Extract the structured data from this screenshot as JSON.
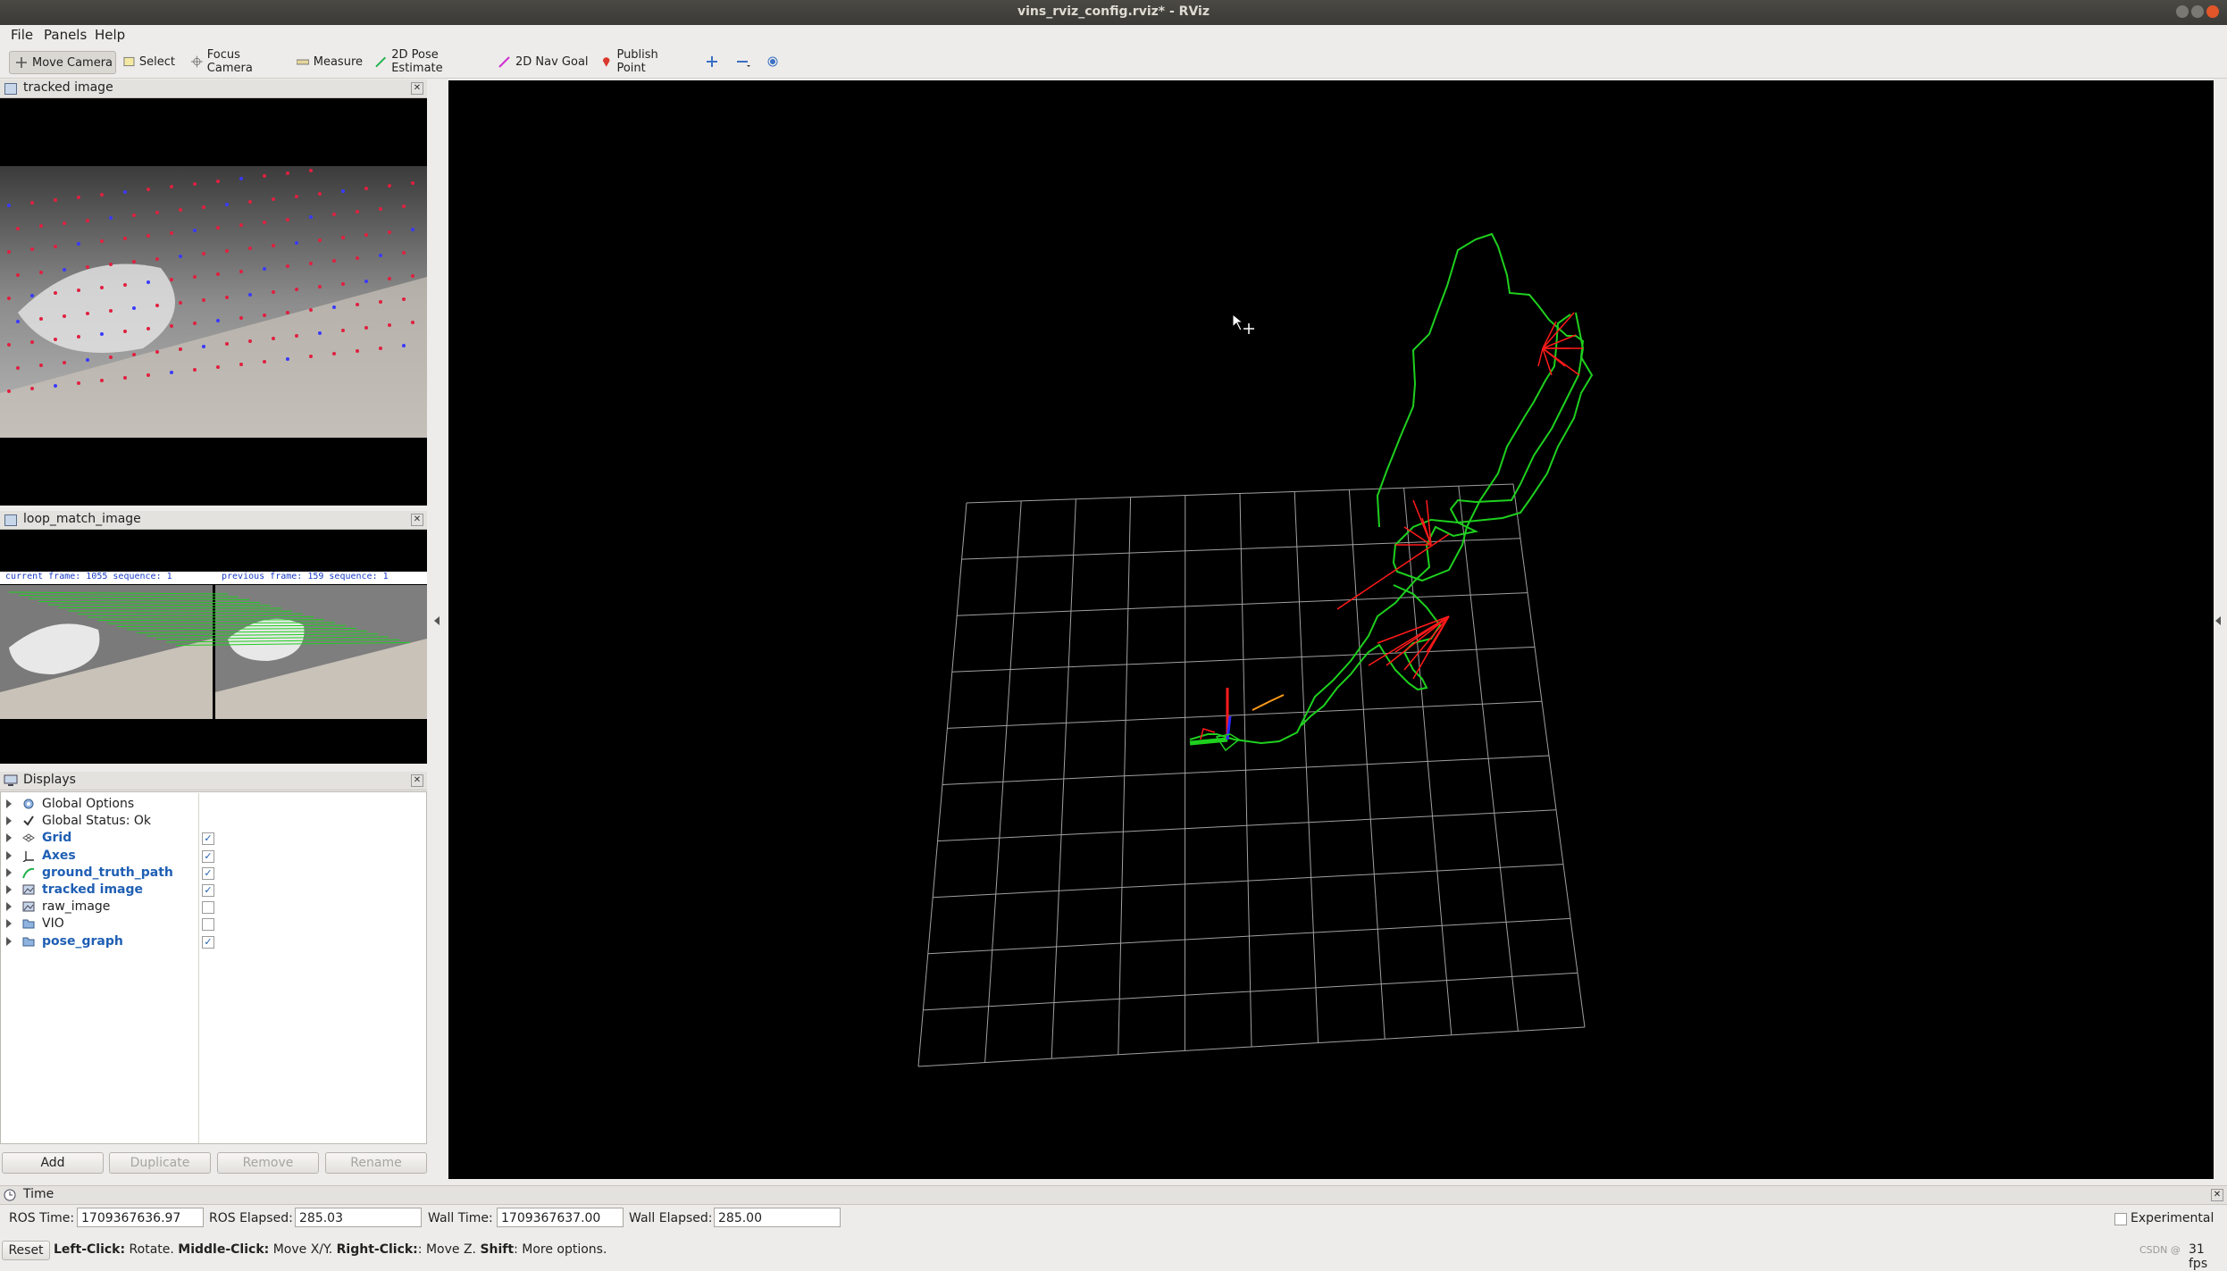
{
  "window": {
    "title": "vins_rviz_config.rviz* - RViz"
  },
  "menubar": {
    "items": [
      "File",
      "Panels",
      "Help"
    ]
  },
  "toolbar": {
    "tools": [
      "Move Camera",
      "Select",
      "Focus Camera",
      "Measure",
      "2D Pose Estimate",
      "2D Nav Goal",
      "Publish Point"
    ],
    "active": "Move Camera"
  },
  "panels": {
    "tracked_image": {
      "title": "tracked image"
    },
    "loop_match_image": {
      "title": "loop_match_image",
      "current_frame_text": "current frame: 1055   sequence: 1",
      "previous_frame_text": "previous frame: 159   sequence: 1"
    },
    "displays": {
      "title": "Displays",
      "items": [
        {
          "label": "Global Options",
          "icon": "gear-icon",
          "checked": null,
          "enabled": false
        },
        {
          "label": "Global Status: Ok",
          "icon": "checkmark-icon",
          "checked": null,
          "enabled": false
        },
        {
          "label": "Grid",
          "icon": "grid-icon",
          "checked": true,
          "enabled": true
        },
        {
          "label": "Axes",
          "icon": "axes-icon",
          "checked": true,
          "enabled": true
        },
        {
          "label": "ground_truth_path",
          "icon": "path-icon",
          "checked": true,
          "enabled": true
        },
        {
          "label": "tracked image",
          "icon": "image-icon",
          "checked": true,
          "enabled": true
        },
        {
          "label": "raw_image",
          "icon": "image-icon",
          "checked": false,
          "enabled": false
        },
        {
          "label": "VIO",
          "icon": "folder-icon",
          "checked": false,
          "enabled": false
        },
        {
          "label": "pose_graph",
          "icon": "folder-icon",
          "checked": true,
          "enabled": true
        }
      ],
      "buttons": {
        "add": "Add",
        "duplicate": "Duplicate",
        "remove": "Remove",
        "rename": "Rename"
      }
    }
  },
  "time_panel": {
    "title": "Time",
    "ros_time_label": "ROS Time:",
    "ros_time": "1709367636.97",
    "ros_elapsed_label": "ROS Elapsed:",
    "ros_elapsed": "285.03",
    "wall_time_label": "Wall Time:",
    "wall_time": "1709367637.00",
    "wall_elapsed_label": "Wall Elapsed:",
    "wall_elapsed": "285.00",
    "experimental_label": "Experimental"
  },
  "statusbar": {
    "reset_label": "Reset",
    "help_left_bold": "Left-Click:",
    "help_left": " Rotate. ",
    "help_middle_bold": "Middle-Click:",
    "help_middle": " Move X/Y. ",
    "help_right_bold": "Right-Click:",
    "help_right": ": Move Z. ",
    "help_shift_bold": "Shift",
    "help_shift": ": More options.",
    "watermark": "CSDN @",
    "fps": "31 fps"
  },
  "colors": {
    "trajectory": "#1ed01e",
    "loop_edges": "#ff1a1a",
    "grid": "#a0a0a0",
    "accent_blue": "#1f5fb4"
  }
}
